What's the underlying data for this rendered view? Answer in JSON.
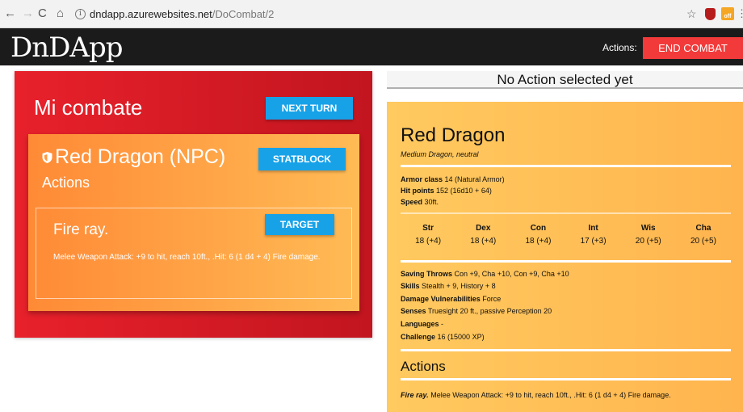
{
  "browser": {
    "url_host": "dndapp.azurewebsites.net",
    "url_path": "/DoCombat/2",
    "back_icon": "←",
    "forward_icon": "→",
    "reload_icon": "C",
    "home_icon": "⌂",
    "info_icon": "i",
    "star_icon": "☆",
    "menu_icon": "⋮",
    "ext_off_label": "off"
  },
  "header": {
    "logo": "DnDApp",
    "actions_label": "Actions:",
    "end_combat_label": "END COMBAT",
    "end_combat_color": "#f23a3a"
  },
  "combat": {
    "title": "Mi combate",
    "next_turn_label": "NEXT TURN",
    "creature": {
      "name": "Red Dragon (NPC)",
      "statblock_label": "STATBLOCK",
      "actions_title": "Actions",
      "action": {
        "name": "Fire ray.",
        "target_label": "TARGET",
        "description": "Melee Weapon Attack: +9 to hit, reach 10ft., .Hit: 6 (1 d4 + 4) Fire damage."
      }
    }
  },
  "action_status": "No Action selected yet",
  "statblock": {
    "name": "Red Dragon",
    "type_line": "Medium Dragon, neutral",
    "armor_class": {
      "label": "Armor class",
      "value": "14 (Natural Armor)"
    },
    "hit_points": {
      "label": "Hit points",
      "value": "152 (16d10 + 64)"
    },
    "speed": {
      "label": "Speed",
      "value": "30ft."
    },
    "abilities": [
      {
        "name": "Str",
        "value": "18 (+4)"
      },
      {
        "name": "Dex",
        "value": "18 (+4)"
      },
      {
        "name": "Con",
        "value": "18 (+4)"
      },
      {
        "name": "Int",
        "value": "17 (+3)"
      },
      {
        "name": "Wis",
        "value": "20 (+5)"
      },
      {
        "name": "Cha",
        "value": "20 (+5)"
      }
    ],
    "saving_throws": {
      "label": "Saving Throws",
      "value": "Con +9, Cha +10, Con +9, Cha +10"
    },
    "skills": {
      "label": "Skills",
      "value": "Stealth + 9, History + 8"
    },
    "damage_vulnerabilities": {
      "label": "Damage Vulnerabilities",
      "value": "Force"
    },
    "senses": {
      "label": "Senses",
      "value": "Truesight 20 ft., passive Perception 20"
    },
    "languages": {
      "label": "Languages",
      "value": "-"
    },
    "challenge": {
      "label": "Challenge",
      "value": "16 (15000 XP)"
    },
    "actions_title": "Actions",
    "action": {
      "name": "Fire ray.",
      "text": "Melee Weapon Attack: +9 to hit, reach 10ft., .Hit: 6 (1 d4 + 4) Fire damage."
    }
  },
  "colors": {
    "accent_blue": "#17a2e8",
    "combat_red": "#e8212b",
    "card_orange": "#ff8a36",
    "statblock_yellow": "#ffca60"
  }
}
